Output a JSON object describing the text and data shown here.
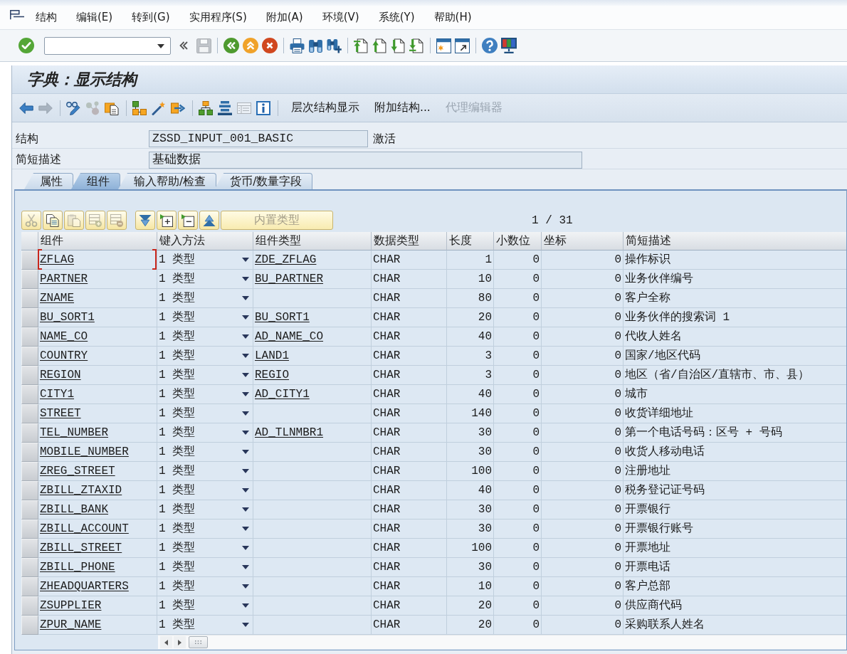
{
  "menu_bar": [
    "结构",
    "编辑(E)",
    "转到(G)",
    "实用程序(S)",
    "附加(A)",
    "环境(V)",
    "系统(Y)",
    "帮助(H)"
  ],
  "standard_toolbar": {
    "groups": [
      [
        {
          "kind": "check",
          "disabled": false
        },
        {
          "kind": "command",
          "disabled": false
        },
        {
          "kind": "collapse",
          "disabled": false
        },
        {
          "kind": "save",
          "disabled": true
        }
      ],
      [
        {
          "kind": "back",
          "disabled": false
        },
        {
          "kind": "exit",
          "disabled": false
        },
        {
          "kind": "cancel",
          "disabled": false
        }
      ],
      [
        {
          "kind": "print",
          "disabled": false
        },
        {
          "kind": "find",
          "disabled": false
        },
        {
          "kind": "findnext",
          "disabled": false
        }
      ],
      [
        {
          "kind": "first",
          "disabled": false
        },
        {
          "kind": "prev",
          "disabled": false
        },
        {
          "kind": "next",
          "disabled": false
        },
        {
          "kind": "last",
          "disabled": false
        }
      ],
      [
        {
          "kind": "newwindow",
          "disabled": false
        },
        {
          "kind": "shortcut",
          "disabled": false
        }
      ],
      [
        {
          "kind": "help",
          "disabled": false
        },
        {
          "kind": "layout",
          "disabled": false
        }
      ]
    ]
  },
  "title": "字典：显示结构",
  "app_toolbar": {
    "groups": [
      [
        {
          "kind": "arrowleft",
          "disabled": false
        },
        {
          "kind": "arrowright",
          "disabled": true
        }
      ],
      [
        {
          "kind": "glasses",
          "disabled": false
        },
        {
          "kind": "molecule",
          "disabled": true
        },
        {
          "kind": "clipboard",
          "disabled": false
        }
      ],
      [
        {
          "kind": "nodes",
          "disabled": false
        },
        {
          "kind": "wand",
          "disabled": false
        },
        {
          "kind": "plug",
          "disabled": false
        }
      ],
      [
        {
          "kind": "hierarchy",
          "disabled": false
        },
        {
          "kind": "stack",
          "disabled": false
        },
        {
          "kind": "listview",
          "disabled": true
        },
        {
          "kind": "info",
          "disabled": false
        }
      ]
    ],
    "buttons": [
      {
        "label": "层次结构显示",
        "disabled": false
      },
      {
        "label": "附加结构...",
        "disabled": false
      },
      {
        "label": "代理编辑器",
        "disabled": true
      }
    ]
  },
  "header_fields": [
    {
      "label": "结构",
      "value": "ZSSD_INPUT_001_BASIC",
      "status": "激活"
    },
    {
      "label": "简短描述",
      "value": "基础数据"
    }
  ],
  "tabs": [
    {
      "label": "属性",
      "selected": false
    },
    {
      "label": "组件",
      "selected": true
    },
    {
      "label": "输入帮助/检查",
      "selected": false
    },
    {
      "label": "货币/数量字段",
      "selected": false
    }
  ],
  "table_toolbar": {
    "groups": [
      [
        {
          "kind": "cut",
          "disabled": true
        },
        {
          "kind": "copy",
          "disabled": false
        },
        {
          "kind": "paste",
          "disabled": true
        },
        {
          "kind": "insertrow",
          "disabled": true
        },
        {
          "kind": "deleterow",
          "disabled": true
        }
      ],
      [
        {
          "kind": "down",
          "disabled": false
        },
        {
          "kind": "expand",
          "disabled": false
        },
        {
          "kind": "collapsebox",
          "disabled": false
        },
        {
          "kind": "up",
          "disabled": false
        }
      ]
    ],
    "button": {
      "label": "内置类型",
      "disabled": true
    },
    "page": "1 / 31"
  },
  "table": {
    "columns": [
      "组件",
      "键入方法",
      "组件类型",
      "数据类型",
      "长度",
      "小数位",
      "坐标",
      "简短描述"
    ],
    "rows": [
      {
        "component": "ZFLAG",
        "entry_type": "1 类型",
        "component_type": "ZDE_ZFLAG",
        "data_type": "CHAR",
        "length": "1",
        "decimals": "0",
        "coordinate": "0",
        "description": "操作标识",
        "focused": true
      },
      {
        "component": "PARTNER",
        "entry_type": "1 类型",
        "component_type": "BU_PARTNER",
        "data_type": "CHAR",
        "length": "10",
        "decimals": "0",
        "coordinate": "0",
        "description": "业务伙伴编号",
        "focused": false
      },
      {
        "component": "ZNAME",
        "entry_type": "1 类型",
        "data_type": "CHAR",
        "length": "80",
        "decimals": "0",
        "coordinate": "0",
        "description": "客户全称",
        "focused": false
      },
      {
        "component": "BU_SORT1",
        "entry_type": "1 类型",
        "component_type": "BU_SORT1",
        "data_type": "CHAR",
        "length": "20",
        "decimals": "0",
        "coordinate": "0",
        "description": "业务伙伴的搜索词 1",
        "focused": false
      },
      {
        "component": "NAME_CO",
        "entry_type": "1 类型",
        "component_type": "AD_NAME_CO",
        "data_type": "CHAR",
        "length": "40",
        "decimals": "0",
        "coordinate": "0",
        "description": "代收人姓名",
        "focused": false
      },
      {
        "component": "COUNTRY",
        "entry_type": "1 类型",
        "component_type": "LAND1",
        "data_type": "CHAR",
        "length": "3",
        "decimals": "0",
        "coordinate": "0",
        "description": "国家/地区代码",
        "focused": false
      },
      {
        "component": "REGION",
        "entry_type": "1 类型",
        "component_type": "REGIO",
        "data_type": "CHAR",
        "length": "3",
        "decimals": "0",
        "coordinate": "0",
        "description": "地区（省/自治区/直辖市、市、县）",
        "focused": false
      },
      {
        "component": "CITY1",
        "entry_type": "1 类型",
        "component_type": "AD_CITY1",
        "data_type": "CHAR",
        "length": "40",
        "decimals": "0",
        "coordinate": "0",
        "description": "城市",
        "focused": false
      },
      {
        "component": "STREET",
        "entry_type": "1 类型",
        "data_type": "CHAR",
        "length": "140",
        "decimals": "0",
        "coordinate": "0",
        "description": "收货详细地址",
        "focused": false
      },
      {
        "component": "TEL_NUMBER",
        "entry_type": "1 类型",
        "component_type": "AD_TLNMBR1",
        "data_type": "CHAR",
        "length": "30",
        "decimals": "0",
        "coordinate": "0",
        "description": "第一个电话号码：区号 + 号码",
        "focused": false
      },
      {
        "component": "MOBILE_NUMBER",
        "entry_type": "1 类型",
        "data_type": "CHAR",
        "length": "30",
        "decimals": "0",
        "coordinate": "0",
        "description": "收货人移动电话",
        "focused": false
      },
      {
        "component": "ZREG_STREET",
        "entry_type": "1 类型",
        "data_type": "CHAR",
        "length": "100",
        "decimals": "0",
        "coordinate": "0",
        "description": "注册地址",
        "focused": false
      },
      {
        "component": "ZBILL_ZTAXID",
        "entry_type": "1 类型",
        "data_type": "CHAR",
        "length": "40",
        "decimals": "0",
        "coordinate": "0",
        "description": "税务登记证号码",
        "focused": false
      },
      {
        "component": "ZBILL_BANK",
        "entry_type": "1 类型",
        "data_type": "CHAR",
        "length": "30",
        "decimals": "0",
        "coordinate": "0",
        "description": "开票银行",
        "focused": false
      },
      {
        "component": "ZBILL_ACCOUNT",
        "entry_type": "1 类型",
        "data_type": "CHAR",
        "length": "30",
        "decimals": "0",
        "coordinate": "0",
        "description": "开票银行账号",
        "focused": false
      },
      {
        "component": "ZBILL_STREET",
        "entry_type": "1 类型",
        "data_type": "CHAR",
        "length": "100",
        "decimals": "0",
        "coordinate": "0",
        "description": "开票地址",
        "focused": false
      },
      {
        "component": "ZBILL_PHONE",
        "entry_type": "1 类型",
        "data_type": "CHAR",
        "length": "30",
        "decimals": "0",
        "coordinate": "0",
        "description": "开票电话",
        "focused": false
      },
      {
        "component": "ZHEADQUARTERS",
        "entry_type": "1 类型",
        "data_type": "CHAR",
        "length": "10",
        "decimals": "0",
        "coordinate": "0",
        "description": "客户总部",
        "focused": false
      },
      {
        "component": "ZSUPPLIER",
        "entry_type": "1 类型",
        "data_type": "CHAR",
        "length": "20",
        "decimals": "0",
        "coordinate": "0",
        "description": "供应商代码",
        "focused": false
      },
      {
        "component": "ZPUR_NAME",
        "entry_type": "1 类型",
        "data_type": "CHAR",
        "length": "20",
        "decimals": "0",
        "coordinate": "0",
        "description": "采购联系人姓名",
        "focused": false
      }
    ]
  }
}
